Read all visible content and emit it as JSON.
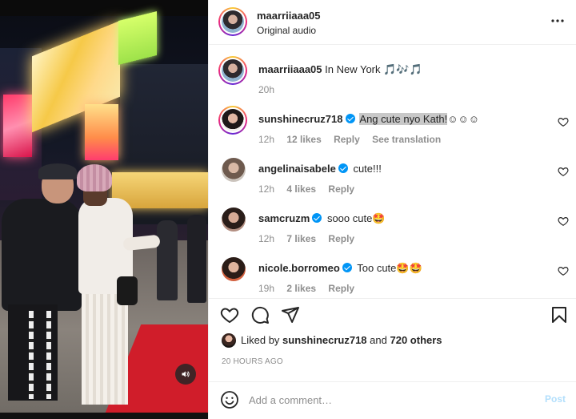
{
  "post": {
    "username": "maarriiaaa05",
    "audio_label": "Original audio"
  },
  "caption": {
    "username": "maarriiaaa05",
    "text": "In New York 🎵🎶🎵",
    "time": "20h"
  },
  "comments": [
    {
      "username": "sunshinecruz718",
      "verified": true,
      "text_highlighted": "Ang cute nyo Kath!",
      "text_rest": "☺☺☺",
      "time": "12h",
      "likes": "12 likes",
      "reply": "Reply",
      "translate": "See translation"
    },
    {
      "username": "angelinaisabele",
      "verified": true,
      "text": "cute!!!",
      "time": "12h",
      "likes": "4 likes",
      "reply": "Reply"
    },
    {
      "username": "samcruzm",
      "verified": true,
      "text": "sooo cute🤩",
      "time": "12h",
      "likes": "7 likes",
      "reply": "Reply"
    },
    {
      "username": "nicole.borromeo",
      "verified": true,
      "text": "Too cute🤩🤩",
      "time": "19h",
      "likes": "2 likes",
      "reply": "Reply"
    }
  ],
  "liked_by": {
    "prefix": "Liked by",
    "user": "sunshinecruz718",
    "middle": "and",
    "others": "720 others"
  },
  "timestamp": "20 HOURS AGO",
  "add_comment": {
    "placeholder": "Add a comment…",
    "post_label": "Post"
  },
  "icons": {
    "more": "more-horizontal-icon",
    "like": "heart-icon",
    "comment": "comment-bubble-icon",
    "share": "paper-plane-icon",
    "save": "bookmark-icon",
    "emoji": "smiley-icon",
    "sound": "speaker-icon"
  },
  "colors": {
    "verified": "#0095f6",
    "muted_text": "#8e8e8e",
    "post_disabled": "#b2dffc"
  }
}
